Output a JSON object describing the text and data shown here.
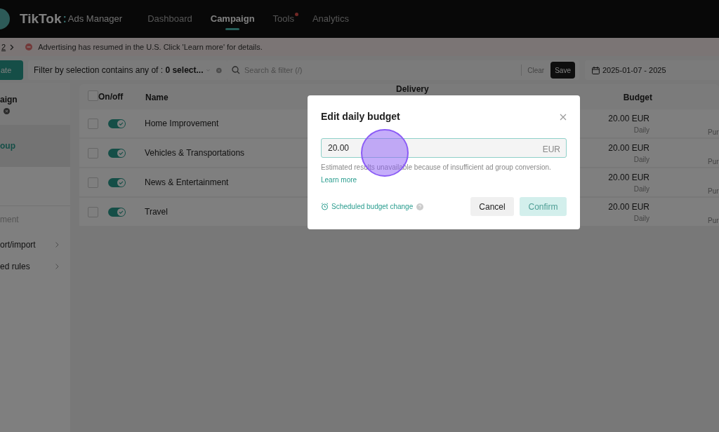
{
  "nav": {
    "brand": "TikTok",
    "brand_separator": ":",
    "product": "Ads Manager",
    "tabs": [
      {
        "label": "Dashboard",
        "selected": false,
        "badge": false
      },
      {
        "label": "Campaign",
        "selected": true,
        "badge": false
      },
      {
        "label": "Tools",
        "selected": false,
        "badge": true
      },
      {
        "label": "Analytics",
        "selected": false,
        "badge": false
      }
    ]
  },
  "banner": {
    "breadcrumb": "2",
    "message": "Advertising has resumed in the U.S. Click 'Learn more' for details."
  },
  "toolbar": {
    "create_button": "ate",
    "filter": "Filter by selection contains any of : **0 select...**",
    "search_placeholder": "Search & filter (/)",
    "clear": "Clear",
    "save": "Save",
    "date_range": "2025-01-07 - 2025"
  },
  "sidebar": {
    "levels": [
      {
        "label": "aign",
        "selected": false
      },
      {
        "label": "oup",
        "selected": true
      }
    ],
    "section_title": "ment",
    "menu": [
      "ort/import",
      "ed rules"
    ]
  },
  "table": {
    "select_all_checked": false,
    "columns": [
      "On/off",
      "Name",
      "Delivery",
      "Budget"
    ],
    "rows": [
      {
        "checked": false,
        "on": true,
        "name": "Home Improvement",
        "budget": "20.00 EUR",
        "budget_type": "Daily",
        "column_6": "Pur"
      },
      {
        "checked": false,
        "on": true,
        "name": "Vehicles & Transportations",
        "budget": "20.00 EUR",
        "budget_type": "Daily",
        "column_6": "Pur"
      },
      {
        "checked": false,
        "on": true,
        "name": "News & Entertainment",
        "budget": "20.00 EUR",
        "budget_type": "Daily",
        "column_6": "Pur"
      },
      {
        "checked": false,
        "on": true,
        "name": "Travel",
        "budget": "20.00 EUR",
        "budget_type": "Daily",
        "column_6": "Pur"
      }
    ]
  },
  "modal": {
    "title": "Edit daily budget",
    "value": "20.00",
    "unit": "EUR",
    "hint": "Estimated results unavailable because of insufficient ad group conversion.",
    "link": "Learn more",
    "scheduled": "Scheduled budget change",
    "cancel": "Cancel",
    "confirm": "Confirm",
    "confirm_disabled": true
  }
}
